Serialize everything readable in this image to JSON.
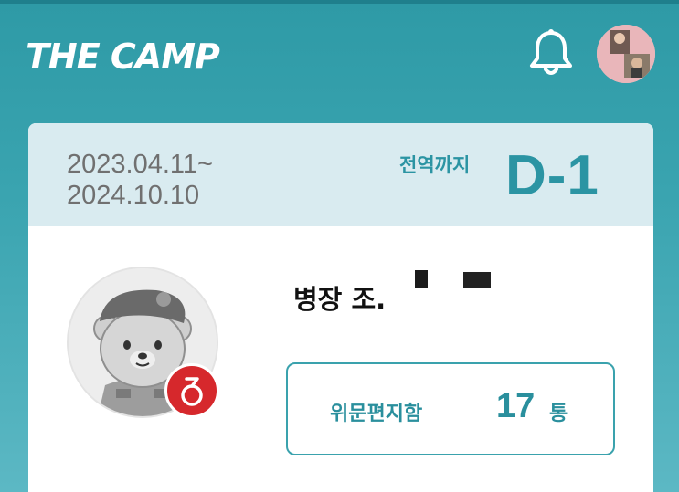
{
  "header": {
    "logo_text": "THE CAMP",
    "notification_icon": "bell-icon",
    "avatar_icon": "user-avatar"
  },
  "card": {
    "period_start": "2023.04.11~",
    "period_end": "2024.10.10",
    "dday_label": "전역까지",
    "dday_value": "D-1",
    "rank_name": "병장 조.",
    "rank_badge_icon": "sergeant-rank-badge",
    "letter_box": {
      "label": "위문편지함",
      "count": "17",
      "unit": "통"
    }
  },
  "colors": {
    "brand": "#3aa4b0",
    "accent": "#2b94a3",
    "badge": "#d6282c"
  }
}
